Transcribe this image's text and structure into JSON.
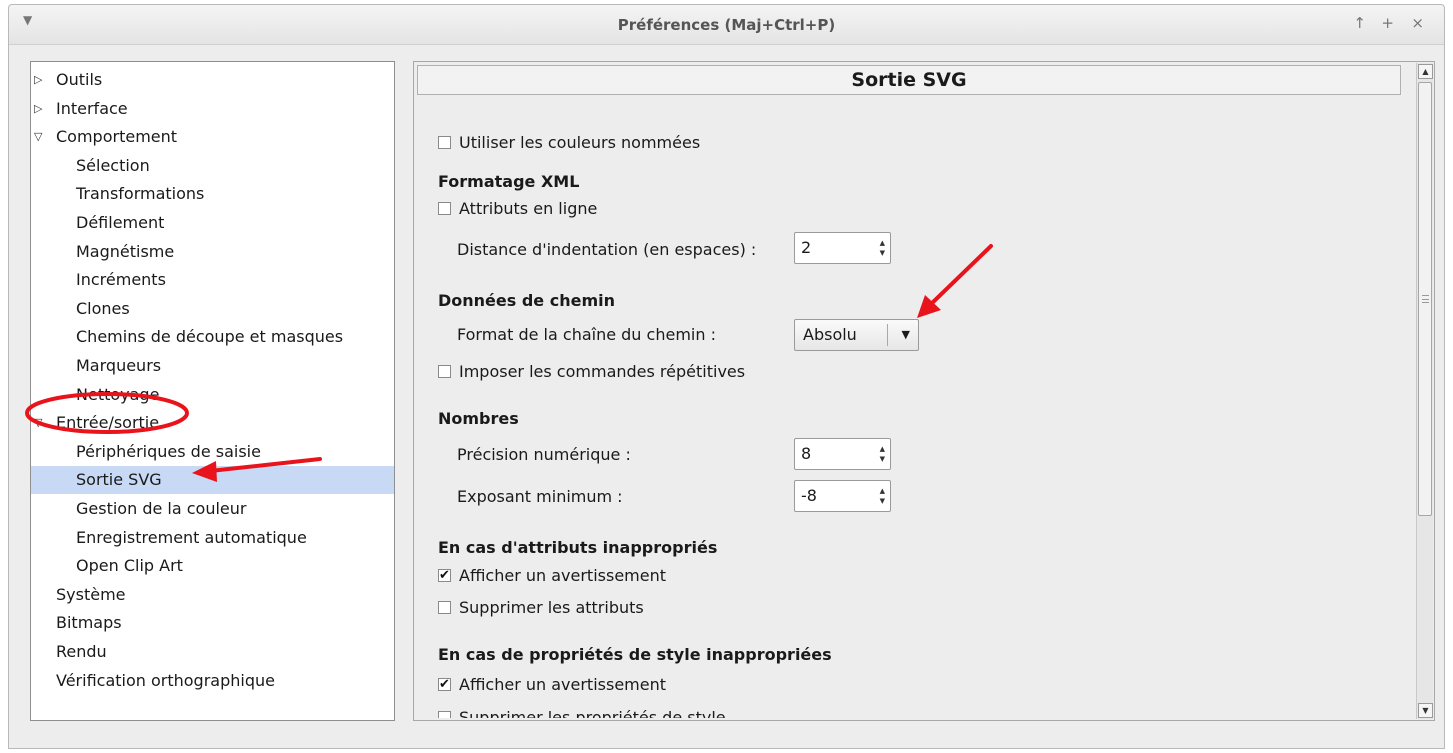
{
  "window": {
    "title": "Préférences (Maj+Ctrl+P)",
    "menu_icon": "chevron-down-icon",
    "controls": [
      "↑",
      "+",
      "×"
    ]
  },
  "tree": {
    "items": [
      {
        "label": "Outils",
        "expander": "▷"
      },
      {
        "label": "Interface",
        "expander": "▷"
      },
      {
        "label": "Comportement",
        "expander": "▽"
      },
      {
        "label": "Sélection"
      },
      {
        "label": "Transformations"
      },
      {
        "label": "Défilement"
      },
      {
        "label": "Magnétisme"
      },
      {
        "label": "Incréments"
      },
      {
        "label": "Clones"
      },
      {
        "label": "Chemins de découpe et masques"
      },
      {
        "label": "Marqueurs"
      },
      {
        "label": "Nettoyage"
      },
      {
        "label": "Entrée/sortie",
        "expander": "▽"
      },
      {
        "label": "Périphériques de saisie"
      },
      {
        "label": "Sortie SVG",
        "selected": true
      },
      {
        "label": "Gestion de la couleur"
      },
      {
        "label": "Enregistrement automatique"
      },
      {
        "label": "Open Clip Art"
      },
      {
        "label": "Système"
      },
      {
        "label": "Bitmaps"
      },
      {
        "label": "Rendu"
      },
      {
        "label": "Vérification orthographique"
      }
    ]
  },
  "pane": {
    "header": "Sortie SVG",
    "named_colors": {
      "label": "Utiliser les couleurs nommées",
      "checked": false
    },
    "xml": {
      "section": "Formatage XML",
      "inline_attrs": {
        "label": "Attributs en ligne",
        "checked": false
      },
      "indent_label": "Distance d'indentation (en espaces) :",
      "indent_value": "2"
    },
    "path": {
      "section": "Données de chemin",
      "format_label": "Format de la chaîne du chemin :",
      "format_value": "Absolu",
      "force_repeat": {
        "label": "Imposer les commandes répétitives",
        "checked": false
      }
    },
    "numbers": {
      "section": "Nombres",
      "precision_label": "Précision numérique :",
      "precision_value": "8",
      "exponent_label": "Exposant minimum :",
      "exponent_value": "-8"
    },
    "bad_attrs": {
      "section": "En cas d'attributs inappropriés",
      "warn": {
        "label": "Afficher un avertissement",
        "checked": true
      },
      "remove": {
        "label": "Supprimer les attributs",
        "checked": false
      }
    },
    "bad_style": {
      "section": "En cas de propriétés de style inappropriées",
      "warn": {
        "label": "Afficher un avertissement",
        "checked": true
      },
      "remove": {
        "label": "Supprimer les propriétés de style",
        "checked": false
      }
    }
  },
  "annotation_color": "#e8131b"
}
